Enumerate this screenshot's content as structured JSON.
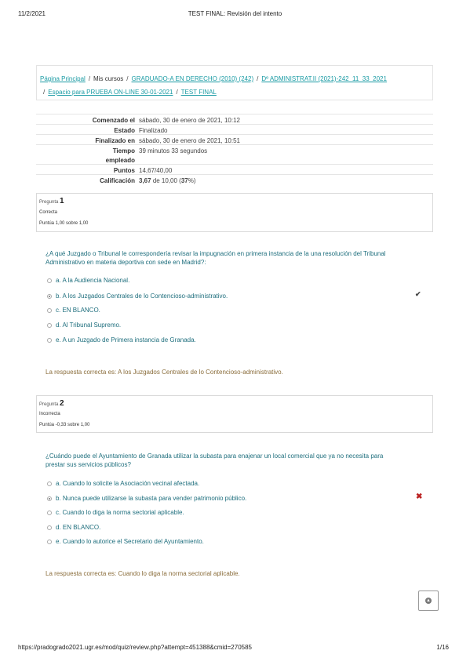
{
  "print": {
    "date": "11/2/2021",
    "title": "TEST FINAL: Revisión del intento",
    "url": "https://pradogrado2021.ugr.es/mod/quiz/review.php?attempt=451388&cmid=270585",
    "page": "1/16"
  },
  "breadcrumb": {
    "items": [
      "Página Principal",
      "Mis cursos",
      "GRADUADO-A EN DERECHO (2010) (242)",
      "Dº ADMINISTRAT.II (2021)-242_11_33_2021",
      "Espacio para PRUEBA ON-LINE 30-01-2021",
      "TEST FINAL"
    ],
    "separator": "/"
  },
  "summary": {
    "rows": [
      {
        "k": "Comenzado el",
        "v": "sábado, 30 de enero de 2021, 10:12"
      },
      {
        "k": "Estado",
        "v": "Finalizado"
      },
      {
        "k": "Finalizado en",
        "v": "sábado, 30 de enero de 2021, 10:51"
      },
      {
        "k": "Tiempo",
        "k2": "empleado",
        "v": "39 minutos 33 segundos"
      },
      {
        "k": "Puntos",
        "v": "14,67/40,00"
      }
    ],
    "grade_label": "Calificación",
    "grade_value": "3,67",
    "grade_mid": "de 10,00 (",
    "grade_pct": "37",
    "grade_end": "%)"
  },
  "questions": [
    {
      "label": "Pregunta",
      "number": "1",
      "state": "Correcta",
      "grade": "Puntúa 1,00 sobre 1,00",
      "text": "¿A qué Juzgado o Tribunal le correspondería revisar la impugnación en primera instancia de la una resolución del Tribunal Administrativo en materia deportiva con sede en Madrid?:",
      "options": [
        "a. A la Audiencia Nacional.",
        "b. A los Juzgados Centrales de lo Contencioso-administrativo.",
        "c. EN BLANCO.",
        "d. Al Tribunal Supremo.",
        "e. A un Juzgado de Primera instancia de Granada."
      ],
      "selected": 1,
      "mark": "✔",
      "feedback": "La respuesta correcta es: A los Juzgados Centrales de lo Contencioso-administrativo."
    },
    {
      "label": "Pregunta",
      "number": "2",
      "state": "Incorrecta",
      "grade": "Puntúa -0,33 sobre 1,00",
      "text": "¿Cuándo puede el Ayuntamiento de Granada utilizar la subasta para enajenar un local comercial que ya no necesita para prestar sus servicios públicos?",
      "options": [
        "a. Cuando lo solicite la Asociación vecinal afectada.",
        "b. Nunca puede utilizarse la subasta para vender patrimonio público.",
        "c. Cuando lo diga la norma sectorial aplicable.",
        "d. EN BLANCO.",
        "e. Cuando lo autorice el Secretario del Ayuntamiento."
      ],
      "selected": 1,
      "mark": "✖",
      "feedback": "La respuesta correcta es: Cuando lo diga la norma sectorial aplicable."
    }
  ],
  "icons": {
    "correct": "check-icon",
    "incorrect": "cross-icon",
    "scroll_top": "arrow-up-icon"
  },
  "colors": {
    "link": "#1a9ba4",
    "question_text": "#1e6e7d",
    "feedback": "#8a6d3b",
    "incorrect": "#bb2222"
  }
}
